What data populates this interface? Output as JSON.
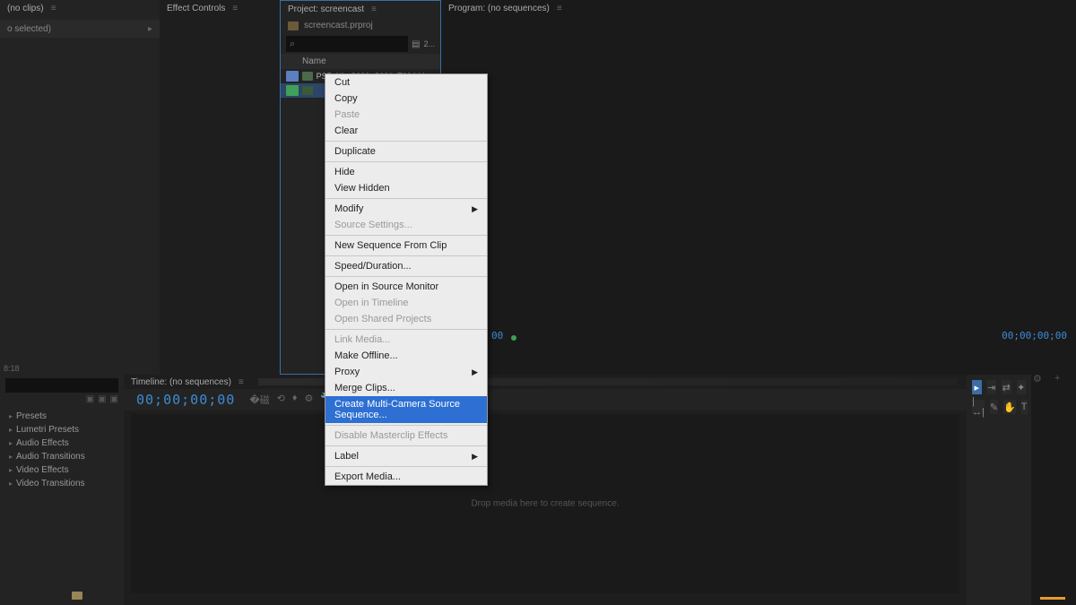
{
  "source": {
    "tab": "(no clips)",
    "subbar": "o selected)",
    "timecode_small": "8:18"
  },
  "effect_controls": {
    "tab": "Effect Controls"
  },
  "project": {
    "tab": "Project: screencast",
    "filename": "screencast.prproj",
    "search_placeholder": "",
    "col_header": "Name",
    "clips": [
      {
        "name": "PS7_NL_S001_S001_T004.MOV",
        "label_color": "blue",
        "selected": false
      },
      {
        "name": "",
        "label_color": "green",
        "selected": true
      }
    ],
    "footer_count": "2..."
  },
  "program": {
    "tab": "Program: (no sequences)",
    "tc_left": "00",
    "tc_right": "00;00;00;00"
  },
  "effects_browser": {
    "items": [
      "Presets",
      "Lumetri Presets",
      "Audio Effects",
      "Audio Transitions",
      "Video Effects",
      "Video Transitions"
    ]
  },
  "timeline": {
    "tab": "Timeline: (no sequences)",
    "timecode": "00;00;00;00",
    "drop_msg": "Drop media here to create sequence."
  },
  "context_menu": {
    "items": [
      {
        "label": "Cut"
      },
      {
        "label": "Copy"
      },
      {
        "label": "Paste",
        "disabled": true
      },
      {
        "label": "Clear"
      },
      {
        "sep": true
      },
      {
        "label": "Duplicate"
      },
      {
        "sep": true
      },
      {
        "label": "Hide"
      },
      {
        "label": "View Hidden"
      },
      {
        "sep": true
      },
      {
        "label": "Modify",
        "submenu": true
      },
      {
        "label": "Source Settings...",
        "disabled": true
      },
      {
        "sep": true
      },
      {
        "label": "New Sequence From Clip"
      },
      {
        "sep": true
      },
      {
        "label": "Speed/Duration..."
      },
      {
        "sep": true
      },
      {
        "label": "Open in Source Monitor"
      },
      {
        "label": "Open in Timeline",
        "disabled": true
      },
      {
        "label": "Open Shared Projects",
        "disabled": true
      },
      {
        "sep": true
      },
      {
        "label": "Link Media...",
        "disabled": true
      },
      {
        "label": "Make Offline..."
      },
      {
        "label": "Proxy",
        "submenu": true
      },
      {
        "label": "Merge Clips..."
      },
      {
        "label": "Create Multi-Camera Source Sequence...",
        "highlight": true
      },
      {
        "sep": true
      },
      {
        "label": "Disable Masterclip Effects",
        "disabled": true
      },
      {
        "sep": true
      },
      {
        "label": "Label",
        "submenu": true
      },
      {
        "sep": true
      },
      {
        "label": "Export Media..."
      }
    ]
  }
}
